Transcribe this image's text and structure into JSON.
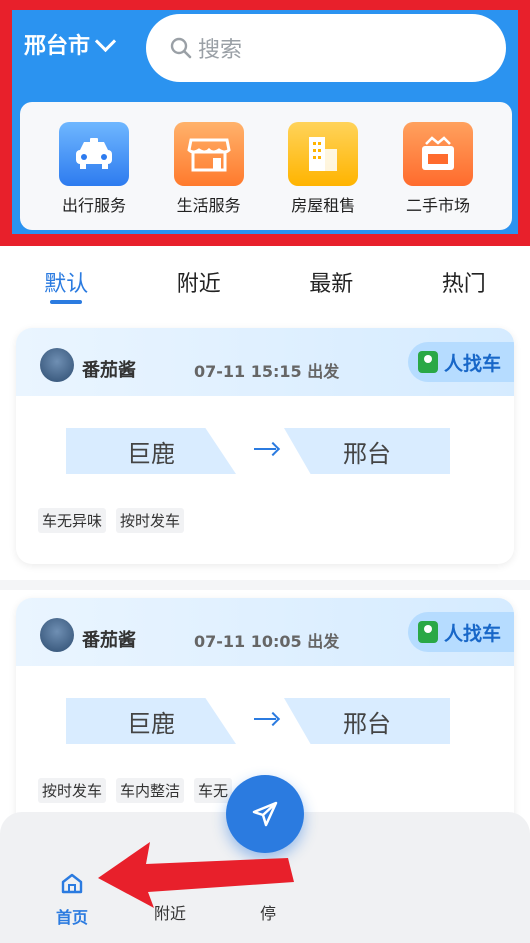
{
  "header": {
    "city": "邢台市",
    "search_placeholder": "搜索",
    "categories": [
      {
        "label": "出行服务",
        "icon": "taxi-icon"
      },
      {
        "label": "生活服务",
        "icon": "shop-icon"
      },
      {
        "label": "房屋租售",
        "icon": "building-icon"
      },
      {
        "label": "二手市场",
        "icon": "second-hand-icon"
      }
    ],
    "highlight_color": "#e8202b",
    "accent": "#2b93f0"
  },
  "tabs": [
    "默认",
    "附近",
    "最新",
    "热门"
  ],
  "active_tab": "默认",
  "rides": [
    {
      "user": "番茄酱",
      "time": "07-11 15:15 出发",
      "badge": "人找车",
      "from": "巨鹿",
      "to": "邢台",
      "tags": [
        "车无异味",
        "按时发车"
      ]
    },
    {
      "user": "番茄酱",
      "time": "07-11 10:05 出发",
      "badge": "人找车",
      "from": "巨鹿",
      "to": "邢台",
      "tags": [
        "按时发车",
        "车内整洁",
        "车无"
      ]
    }
  ],
  "bottom_nav": {
    "items": [
      {
        "label": "首页",
        "icon": "home-icon"
      },
      {
        "label": "附近",
        "icon": "location-icon"
      },
      {
        "label": "停",
        "icon": "other-icon"
      }
    ]
  }
}
